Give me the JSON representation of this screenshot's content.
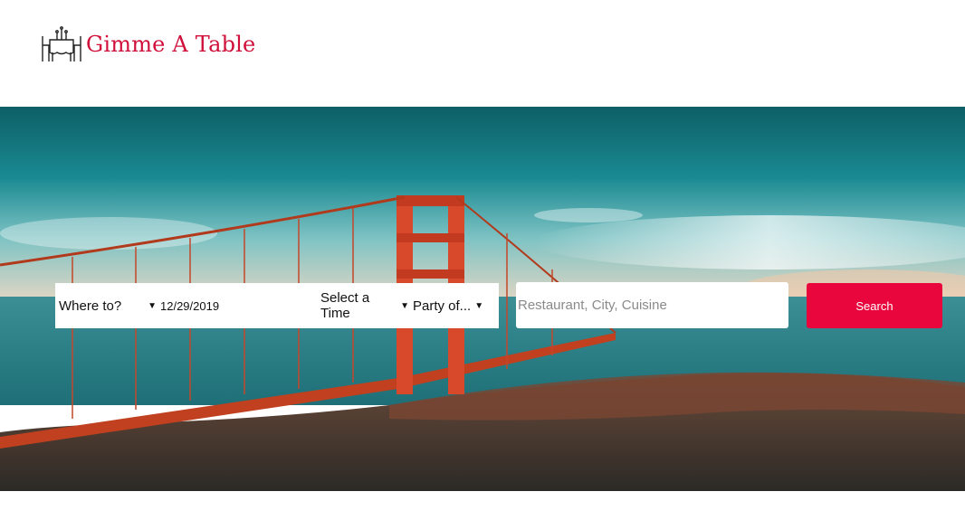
{
  "brand": {
    "name": "Gimme A Table",
    "color": "#d0103a",
    "icon": "dining-table-icon"
  },
  "search": {
    "where_label": "Where to?",
    "date_value": "12/29/2019",
    "time_label": "Select a Time",
    "party_label": "Party of...",
    "query_placeholder": "Restaurant, City, Cuisine",
    "button_label": "Search",
    "button_color": "#e8063c"
  },
  "hero": {
    "subject": "golden-gate-bridge-photo"
  }
}
